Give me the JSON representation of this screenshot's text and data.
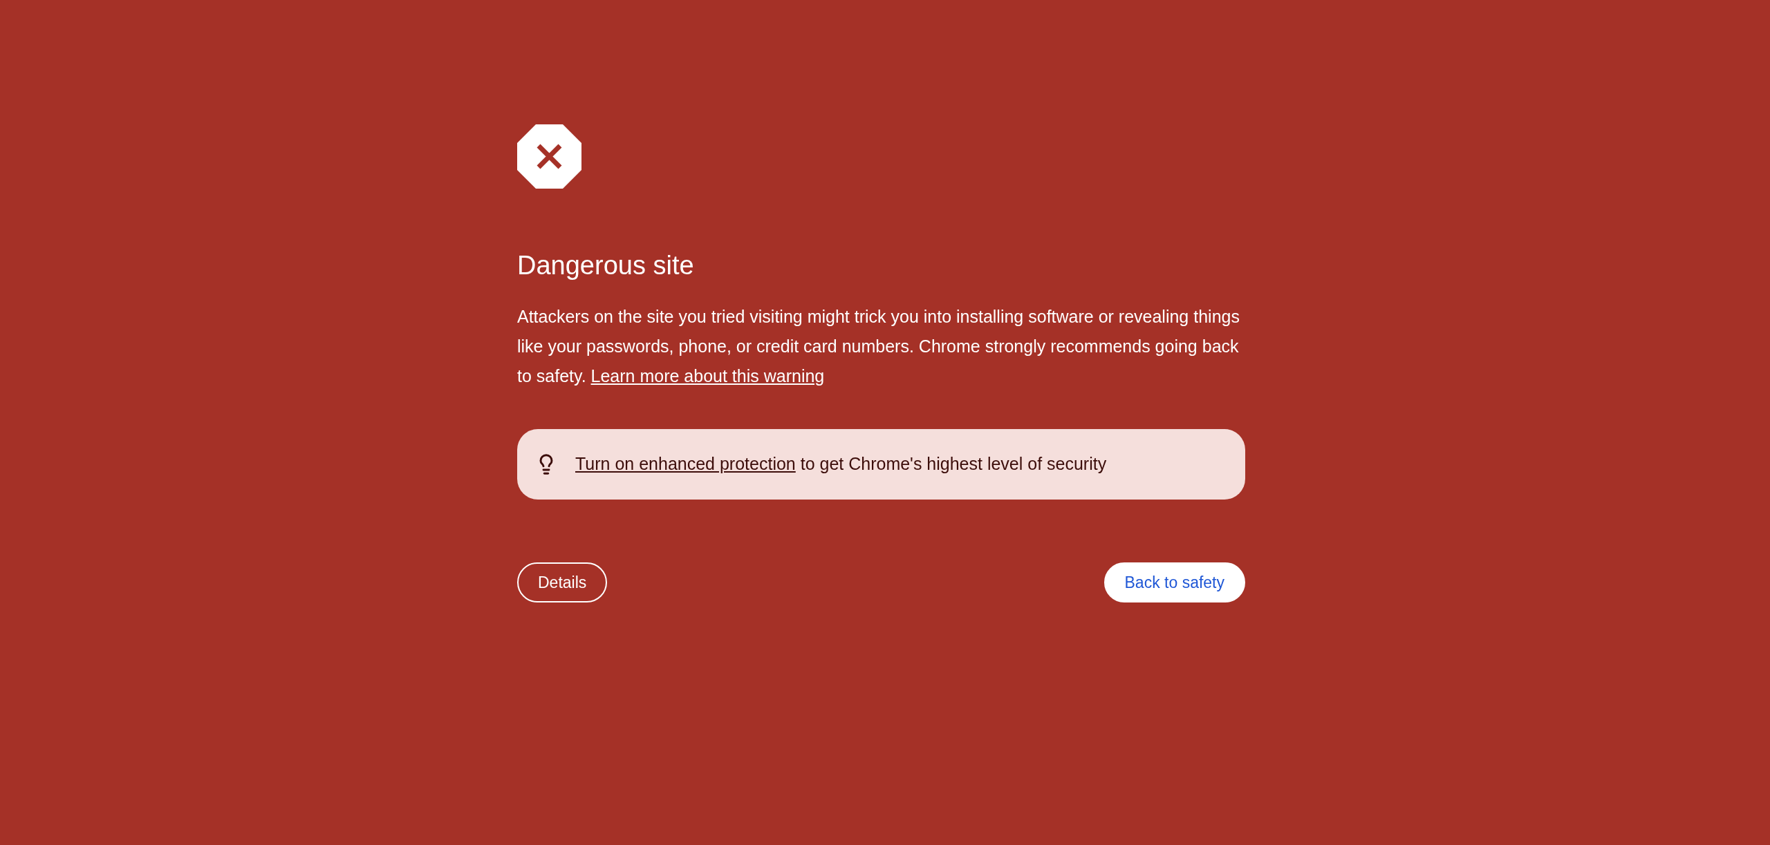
{
  "title": "Dangerous site",
  "body": {
    "text": "Attackers on the site you tried visiting might trick you into installing software or revealing things like your passwords, phone, or credit card numbers. Chrome strongly recommends going back to safety.",
    "link": "Learn more about this warning"
  },
  "promo": {
    "link": "Turn on enhanced protection",
    "text": "to get Chrome's highest level of security"
  },
  "buttons": [
    {
      "label": "Details",
      "kind": "secondary"
    },
    {
      "label": "Back to safety",
      "kind": "primary"
    }
  ]
}
